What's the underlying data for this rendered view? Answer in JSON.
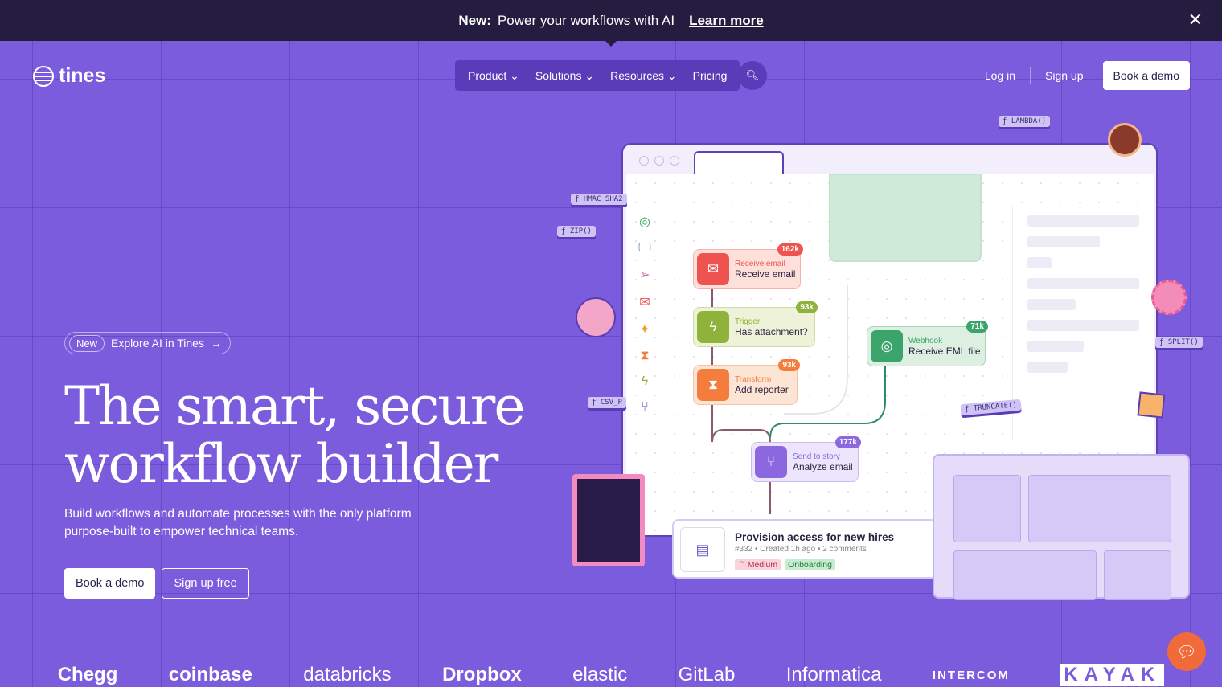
{
  "banner": {
    "bold": "New:",
    "text": "Power your workflows with AI",
    "link": "Learn more",
    "close_icon": "close-icon"
  },
  "brand": "tines",
  "nav": {
    "items": [
      "Product",
      "Solutions",
      "Resources",
      "Pricing"
    ],
    "search_icon": "search-icon"
  },
  "auth": {
    "login": "Log in",
    "signup": "Sign up",
    "demo": "Book a demo"
  },
  "hero": {
    "pill_badge": "New",
    "pill_text": "Explore AI in Tines",
    "pill_arrow": "→",
    "title_line1": "The smart, secure",
    "title_line2": "workflow builder",
    "subtitle": "Build workflows and automate processes with the only platform purpose-built to empower technical teams.",
    "cta_primary": "Book a demo",
    "cta_secondary": "Sign up free"
  },
  "workflow": {
    "nodes": [
      {
        "kind": "Receive email",
        "label": "Receive email",
        "count": "162k",
        "color": "#ef5350",
        "bg": "#fde0da",
        "icon": "✉"
      },
      {
        "kind": "Trigger",
        "label": "Has attachment?",
        "count": "93k",
        "color": "#8fb33a",
        "bg": "#eef2d8",
        "icon": "ϟ"
      },
      {
        "kind": "Transform",
        "label": "Add reporter",
        "count": "93k",
        "color": "#f47c3c",
        "bg": "#fde5d6",
        "icon": "⧗"
      },
      {
        "kind": "Webhook",
        "label": "Receive EML file",
        "count": "71k",
        "color": "#3aa46a",
        "bg": "#dcefe0",
        "icon": "◎"
      },
      {
        "kind": "Send to story",
        "label": "Analyze email",
        "count": "177k",
        "color": "#8b68e0",
        "bg": "#ece5fb",
        "icon": "⑂"
      }
    ]
  },
  "functions": [
    "ƒ LAMBDA()",
    "ƒ HMAC_SHA2",
    "ƒ ZIP()",
    "ƒ SPLIT()",
    "ƒ CSV_P",
    "ƒ TRUNCATE()"
  ],
  "card": {
    "title": "Provision access for new hires",
    "meta": "#332 • Created 1h ago • 2 comments",
    "priority": "⌃ Medium",
    "tag": "Onboarding"
  },
  "logos": [
    "Chegg",
    "coinbase",
    "databricks",
    "Dropbox",
    "elastic",
    "GitLab",
    "Informatica",
    "INTERCOM",
    "KAYAK"
  ],
  "colors": {
    "background": "#7a5cdc",
    "banner": "#251d3f",
    "nav": "#5b3cb8"
  }
}
